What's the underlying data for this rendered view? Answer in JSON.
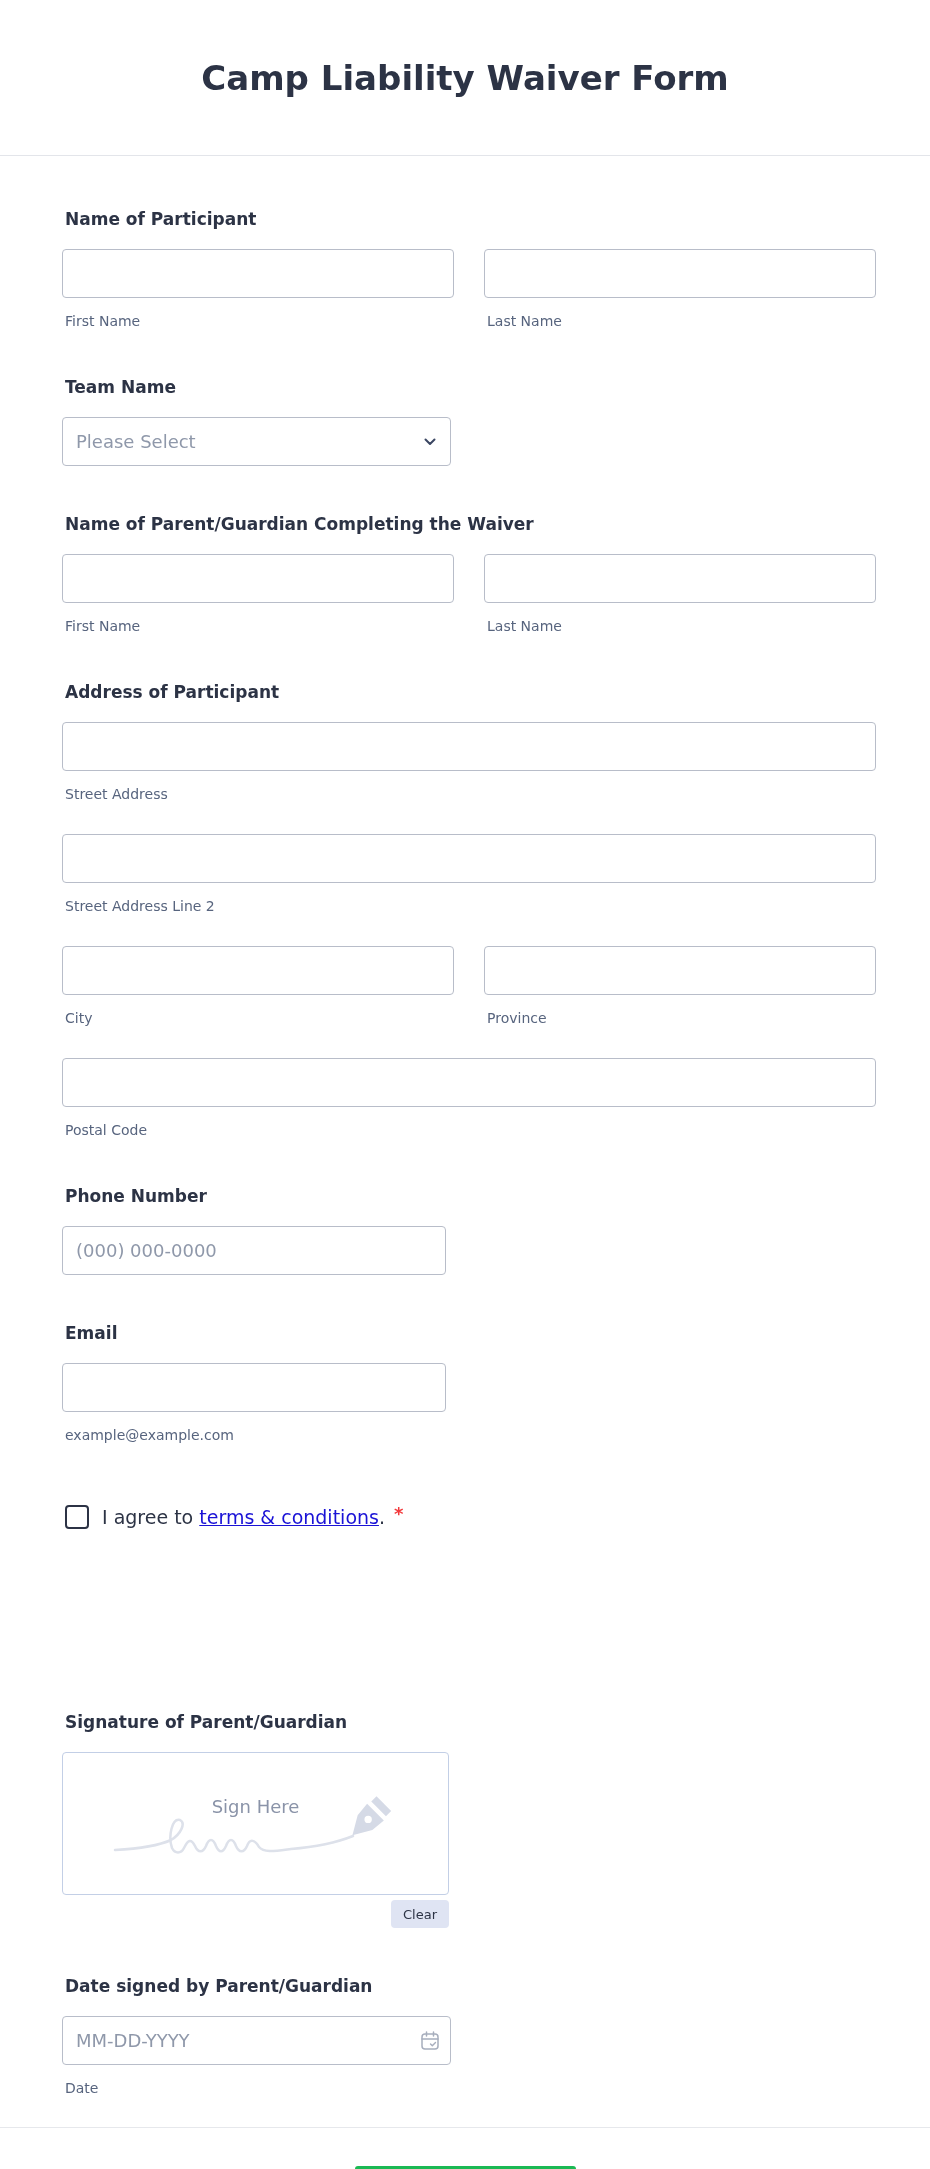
{
  "title": "Camp Liability Waiver Form",
  "fields": [
    {
      "kind": "name",
      "label": "Name of Participant",
      "inputs": [
        {
          "sublabel": "First Name"
        },
        {
          "sublabel": "Last Name"
        }
      ]
    },
    {
      "kind": "dropdown",
      "label": "Team Name",
      "placeholder": "Please Select"
    },
    {
      "kind": "name",
      "label": "Name of Parent/Guardian Completing the Waiver",
      "inputs": [
        {
          "sublabel": "First Name"
        },
        {
          "sublabel": "Last Name"
        }
      ]
    },
    {
      "kind": "address",
      "label": "Address of Participant",
      "rows": [
        {
          "inputs": [
            {
              "sublabel": "Street Address"
            }
          ]
        },
        {
          "inputs": [
            {
              "sublabel": "Street Address Line 2"
            }
          ]
        },
        {
          "inputs": [
            {
              "sublabel": "City"
            },
            {
              "sublabel": "Province"
            }
          ]
        },
        {
          "inputs": [
            {
              "sublabel": "Postal Code"
            }
          ]
        }
      ]
    },
    {
      "kind": "phone",
      "label": "Phone Number",
      "placeholder": "(000) 000-0000"
    },
    {
      "kind": "email",
      "label": "Email",
      "sublabel": "example@example.com"
    },
    {
      "kind": "agreement",
      "checked": false,
      "text": "I agree to ",
      "link": "terms & conditions",
      "text_after": ".",
      "required_mark": "*"
    },
    {
      "kind": "signature",
      "label": "Signature of Parent/Guardian",
      "prompt": "Sign Here",
      "clear_button": "Clear"
    },
    {
      "kind": "date",
      "label": "Date signed by Parent/Guardian",
      "placeholder": "MM-DD-YYYY",
      "sublabel": "Date"
    }
  ]
}
